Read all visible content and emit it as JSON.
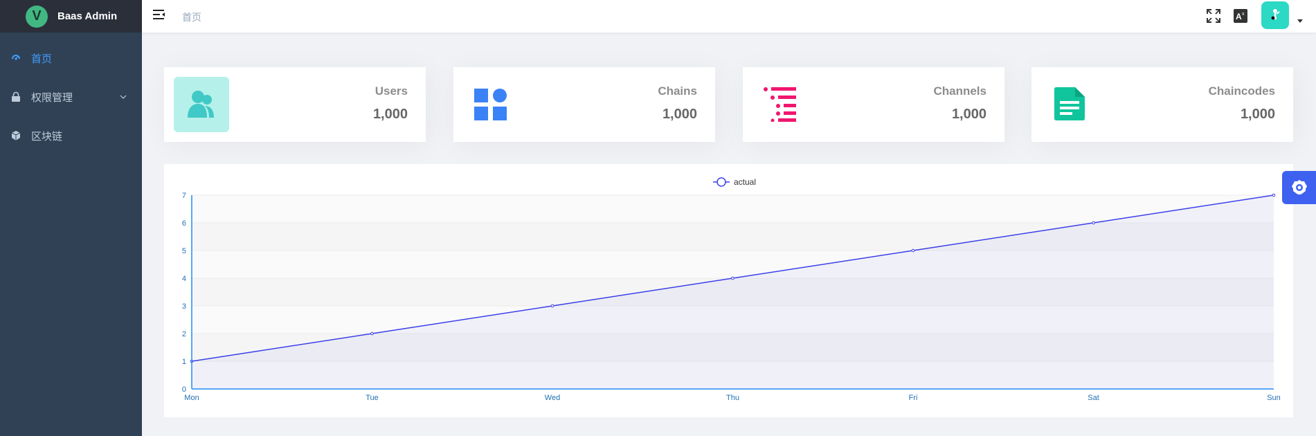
{
  "app": {
    "title": "Baas Admin",
    "logo_letter": "V"
  },
  "sidebar": {
    "items": [
      {
        "label": "首页",
        "icon": "dashboard-icon",
        "active": true
      },
      {
        "label": "权限管理",
        "icon": "lock-icon",
        "active": false,
        "expandable": true
      },
      {
        "label": "区块链",
        "icon": "cube-icon",
        "active": false
      }
    ]
  },
  "header": {
    "breadcrumb": "首页",
    "icons": [
      "menu-fold-icon",
      "fullscreen-icon",
      "language-icon"
    ]
  },
  "cards": [
    {
      "label": "Users",
      "value": "1,000",
      "icon": "users-icon",
      "color": "#40c9c6",
      "bg": "#b5f0ea"
    },
    {
      "label": "Chains",
      "value": "1,000",
      "icon": "apps-icon",
      "color": "#3b82f6",
      "bg": "#ffffff"
    },
    {
      "label": "Channels",
      "value": "1,000",
      "icon": "list-icon",
      "color": "#f4516c",
      "bg": "#ffffff"
    },
    {
      "label": "Chaincodes",
      "value": "1,000",
      "icon": "document-icon",
      "color": "#10c59c",
      "bg": "#ffffff"
    }
  ],
  "chart_data": {
    "type": "area",
    "categories": [
      "Mon",
      "Tue",
      "Wed",
      "Thu",
      "Fri",
      "Sat",
      "Sun"
    ],
    "series": [
      {
        "name": "actual",
        "values": [
          1,
          2,
          3,
          4,
          5,
          6,
          7
        ],
        "color": "#3b3fe8"
      }
    ],
    "yticks": [
      0,
      1,
      2,
      3,
      4,
      5,
      6,
      7
    ],
    "ylim": [
      0,
      7
    ],
    "legend": "top-center",
    "grid": true
  },
  "colors": {
    "sidebar_bg": "#304156",
    "active": "#409eff",
    "settings": "#3e61f0"
  }
}
